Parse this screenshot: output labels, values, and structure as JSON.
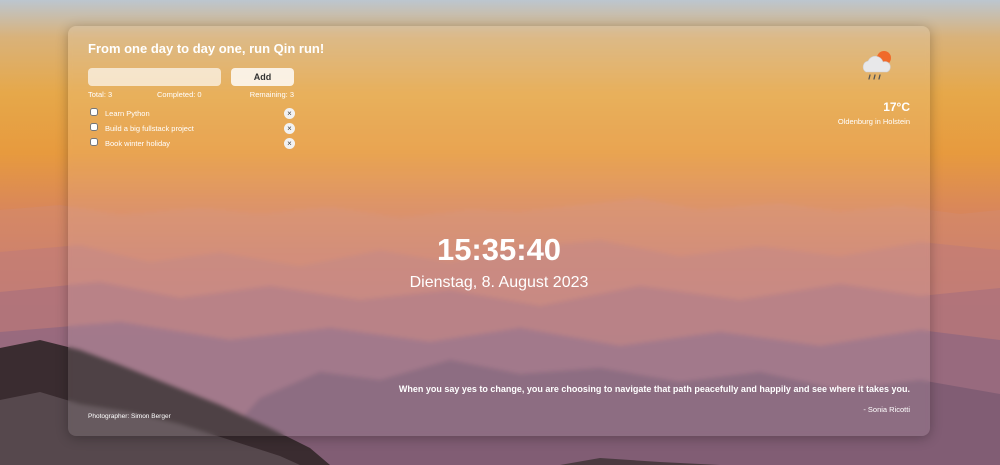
{
  "header": {
    "title": "From one day to day one, run Qin run!"
  },
  "todo": {
    "input_value": "",
    "add_label": "Add",
    "stats": {
      "total": "Total: 3",
      "completed": "Completed: 0",
      "remaining": "Remaining: 3"
    },
    "items": [
      {
        "label": "Learn Python",
        "checked": false,
        "delete": "×"
      },
      {
        "label": "Build a big fullstack project",
        "checked": false,
        "delete": "×"
      },
      {
        "label": "Book winter holiday",
        "checked": false,
        "delete": "×"
      }
    ]
  },
  "weather": {
    "icon": "cloud-rain-sun-icon",
    "temperature": "17°C",
    "city": "Oldenburg in Holstein"
  },
  "clock": {
    "time": "15:35:40",
    "date": "Dienstag, 8. August 2023"
  },
  "quote": {
    "text": "When you say yes to change, you are choosing to navigate that path peacefully and happily and see where it takes you.",
    "author": "- Sonia Ricotti"
  },
  "credit": {
    "photographer": "Photographer: Simon Berger"
  }
}
